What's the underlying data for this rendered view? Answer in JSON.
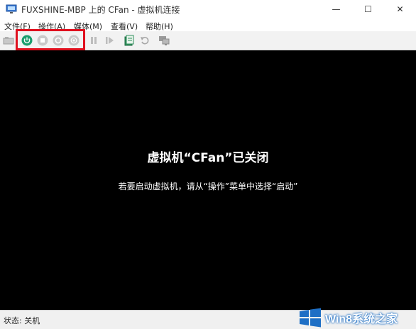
{
  "window": {
    "title": "FUXSHINE-MBP 上的 CFan - 虚拟机连接",
    "controls": {
      "minimize": "—",
      "maximize": "☐",
      "close": "✕"
    }
  },
  "menubar": {
    "items": [
      {
        "label": "文件(F)"
      },
      {
        "label": "操作(A)"
      },
      {
        "label": "媒体(M)"
      },
      {
        "label": "查看(V)"
      },
      {
        "label": "帮助(H)"
      }
    ]
  },
  "toolbar": {
    "icons": [
      "ctrl-alt-del-icon",
      "start-icon",
      "turn-off-icon",
      "shutdown-icon",
      "save-icon",
      "pause-icon",
      "resume-icon",
      "checkpoint-icon",
      "revert-icon",
      "enhanced-session-icon"
    ],
    "accent": "#1a9e6e",
    "highlight_color": "#e0101e"
  },
  "screen": {
    "title": "虚拟机“CFan”已关闭",
    "subtitle": "若要启动虚拟机，请从“操作”菜单中选择“启动”",
    "background": "#000000"
  },
  "statusbar": {
    "text": "状态: 关机"
  },
  "watermark": {
    "text": "Win8系统之家",
    "color": "#1e6fc5"
  }
}
